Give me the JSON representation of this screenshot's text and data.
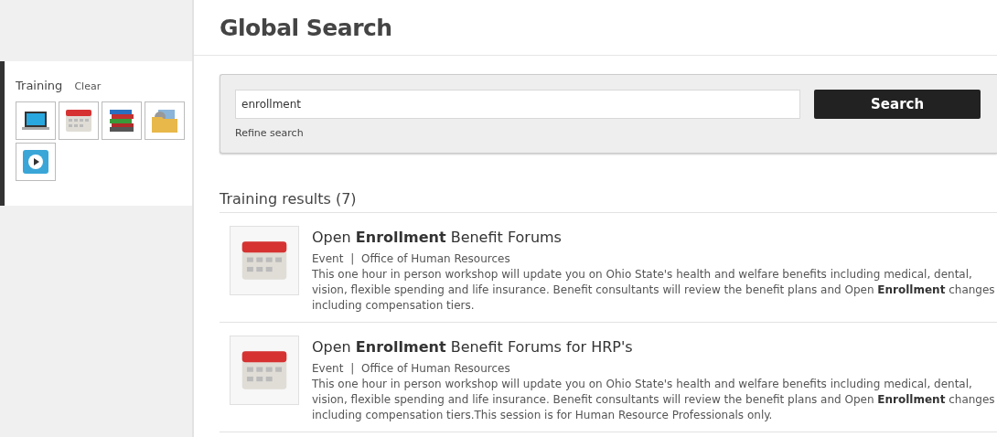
{
  "sidebar": {
    "title": "Training",
    "clear": "Clear",
    "filters": [
      {
        "kind": "laptop"
      },
      {
        "kind": "calendar"
      },
      {
        "kind": "books"
      },
      {
        "kind": "folder"
      },
      {
        "kind": "video"
      }
    ]
  },
  "page_title": "Global Search",
  "search": {
    "value": "enrollment",
    "button": "Search",
    "refine": "Refine search"
  },
  "results_heading": "Training results (7)",
  "results": [
    {
      "kind": "calendar",
      "title": "Open **Enrollment** Benefit Forums",
      "type": "Event",
      "separator": "|",
      "source": "Office of Human Resources",
      "description": "This one hour in person workshop will update you on Ohio State's health and welfare benefits including medical, dental, vision, flexible spending and life insurance. Benefit consultants will review the benefit plans and Open **Enrollment** changes including compensation tiers."
    },
    {
      "kind": "calendar",
      "title": "Open **Enrollment** Benefit Forums for HRP's",
      "type": "Event",
      "separator": "|",
      "source": "Office of Human Resources",
      "description": "This one hour in person workshop will update you on Ohio State's health and welfare benefits including medical, dental, vision, flexible spending and life insurance. Benefit consultants will review the benefit plans and Open **Enrollment** changes including compensation tiers.This session is for Human Resource Professionals only."
    }
  ]
}
